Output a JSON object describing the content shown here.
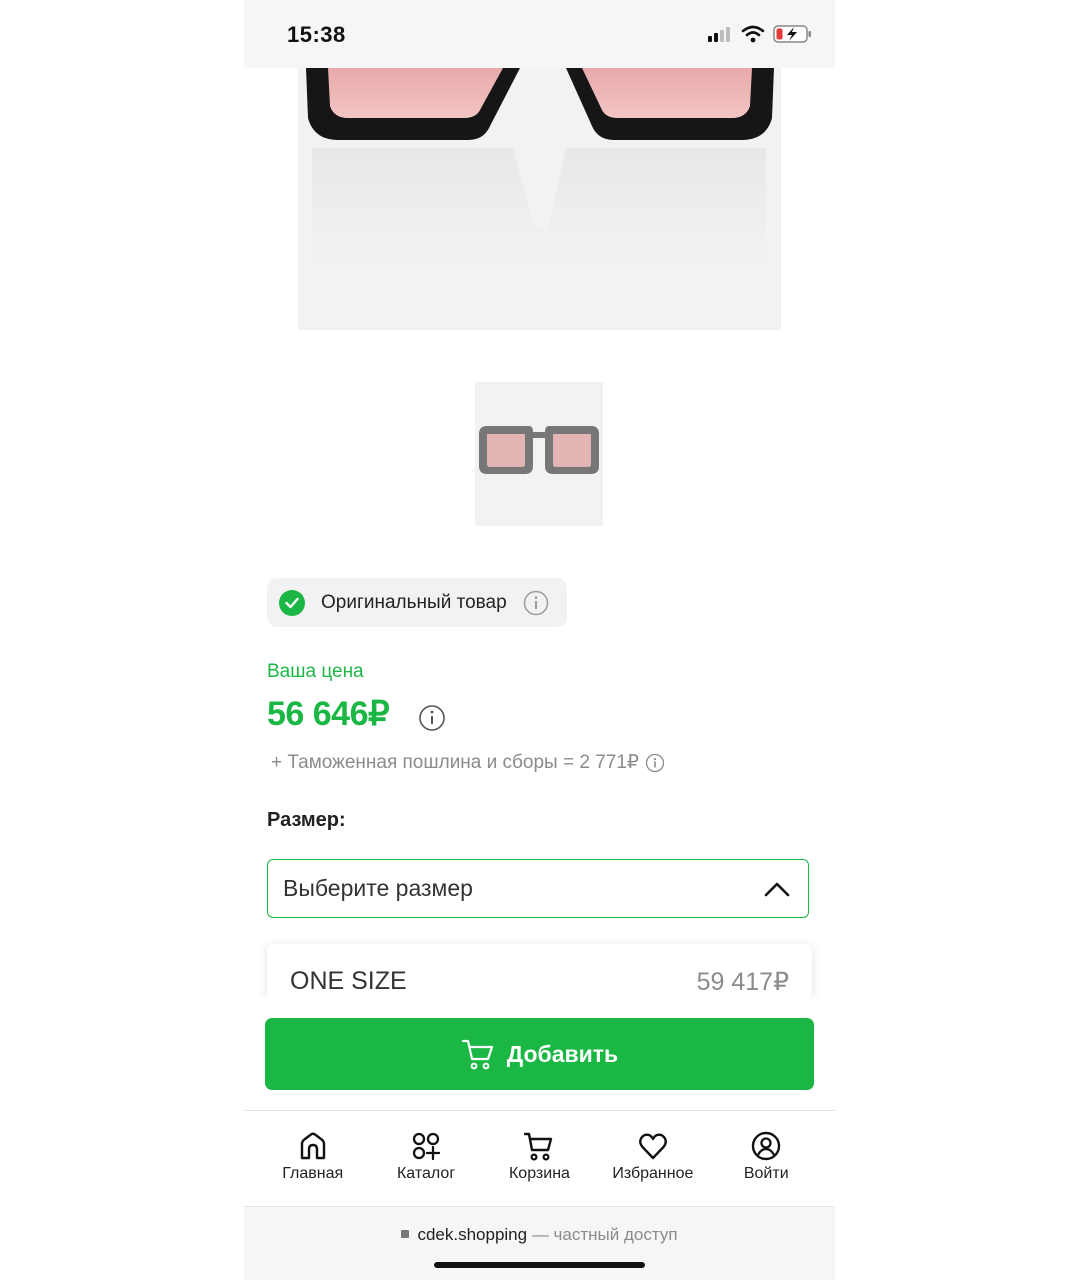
{
  "status_bar": {
    "time": "15:38"
  },
  "product": {
    "original_badge": "Оригинальный товар",
    "price_label": "Ваша цена",
    "price": "56 646₽",
    "duty_text": "+ Таможенная пошлина и сборы = 2 771₽",
    "size_label": "Размер:",
    "size_placeholder": "Выберите размер",
    "size_options": [
      {
        "name": "ONE SIZE",
        "price": "59 417₽"
      }
    ]
  },
  "add_button": {
    "label": "Добавить"
  },
  "tabbar": {
    "items": [
      {
        "label": "Главная",
        "icon": "home-icon"
      },
      {
        "label": "Каталог",
        "icon": "catalog-icon"
      },
      {
        "label": "Корзина",
        "icon": "cart-icon"
      },
      {
        "label": "Избранное",
        "icon": "heart-icon"
      },
      {
        "label": "Войти",
        "icon": "user-icon"
      }
    ]
  },
  "browser": {
    "domain": "cdek.shopping",
    "suffix": "— частный доступ"
  },
  "colors": {
    "accent": "#1bb744",
    "muted": "#8b8b8b"
  }
}
